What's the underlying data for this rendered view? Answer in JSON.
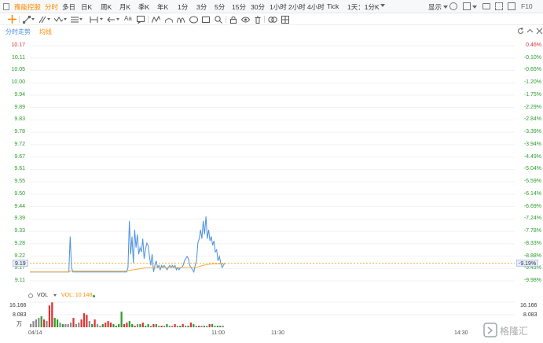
{
  "topbar": {
    "title": "豫能控股",
    "tabs": [
      "分时",
      "多日",
      "日K",
      "周K",
      "月K",
      "季K",
      "年K",
      "1分",
      "3分",
      "5分",
      "15分",
      "30分",
      "1小时",
      "2小时",
      "4小时",
      "Tick",
      "1天：1分K"
    ],
    "active_tab": "分时",
    "display_label": "显示",
    "f10_label": "F10"
  },
  "subbar": {
    "tabs": [
      "分时走势",
      "均线"
    ]
  },
  "price_axis": {
    "left": [
      "10.17",
      "10.11",
      "10.05",
      "10.00",
      "9.94",
      "9.89",
      "9.83",
      "9.78",
      "9.72",
      "9.67",
      "9.61",
      "9.55",
      "9.50",
      "9.44",
      "9.39",
      "9.33",
      "9.28",
      "9.22",
      "9.17",
      "9.11"
    ],
    "right": [
      "0.46%",
      "-0.10%",
      "-0.65%",
      "-1.20%",
      "-1.75%",
      "-2.29%",
      "-2.84%",
      "-3.39%",
      "-3.94%",
      "-4.49%",
      "-5.04%",
      "-5.59%",
      "-6.14%",
      "-6.69%",
      "-7.24%",
      "-7.78%",
      "-8.33%",
      "-8.88%",
      "-9.43%",
      "-9.98%"
    ],
    "current_price": "9.19",
    "current_pct": "-9.19%"
  },
  "volume": {
    "label": "VOL",
    "ma_label": "VOL: 10.148",
    "axis": [
      "16.166",
      "8.083",
      "万"
    ]
  },
  "time_axis": [
    "04/14",
    "11:00",
    "11:30",
    "14:30"
  ],
  "colors": {
    "accent": "#ff8a00",
    "price_line": "#4a90e2",
    "avg_line": "#f5a623",
    "up": "#e03030",
    "down": "#2b9c2b"
  },
  "chart_data": {
    "type": "line",
    "series": [
      {
        "values": [
          9.15,
          9.15,
          9.15,
          9.15,
          9.15,
          9.15,
          9.15,
          9.15,
          9.15,
          9.15,
          9.15,
          9.15,
          9.15,
          9.15,
          9.15,
          9.15,
          9.15,
          9.15,
          9.15,
          9.15,
          9.15,
          9.15,
          9.15,
          9.15,
          9.15,
          9.15,
          9.15,
          9.15,
          9.15,
          9.15,
          9.31,
          9.17,
          9.15,
          9.15,
          9.15,
          9.15,
          9.15,
          9.15,
          9.15,
          9.15,
          9.15,
          9.15,
          9.15,
          9.15,
          9.15,
          9.15,
          9.15,
          9.15,
          9.15,
          9.15,
          9.15,
          9.15,
          9.15,
          9.15,
          9.15,
          9.15,
          9.15,
          9.15,
          9.15,
          9.15,
          9.15,
          9.15,
          9.15,
          9.15,
          9.15,
          9.15,
          9.15,
          9.15,
          9.15,
          9.15,
          9.15,
          9.15,
          9.15,
          9.17,
          9.38,
          9.23,
          9.31,
          9.19,
          9.34,
          9.26,
          9.32,
          9.23,
          9.26,
          9.24,
          9.3,
          9.21,
          9.25,
          9.28,
          9.27,
          9.22,
          9.18,
          9.23,
          9.15,
          9.18,
          9.2,
          9.17,
          9.18,
          9.16,
          9.18,
          9.17,
          9.18,
          9.17,
          9.16,
          9.17,
          9.18,
          9.17,
          9.18,
          9.17,
          9.18,
          9.16,
          9.17,
          9.16,
          9.17,
          9.17,
          9.18,
          9.2,
          9.21,
          9.22,
          9.21,
          9.18,
          9.17,
          9.16,
          9.15,
          9.18,
          9.2,
          9.28,
          9.3,
          9.34,
          9.3,
          9.38,
          9.32,
          9.4,
          9.3,
          9.34,
          9.29,
          9.31,
          9.27,
          9.29,
          9.24,
          9.25,
          9.2,
          9.22,
          9.19,
          9.17,
          9.18,
          9.19
        ]
      },
      {
        "values": [
          9.15,
          9.15,
          9.15,
          9.15,
          9.15,
          9.15,
          9.15,
          9.15,
          9.15,
          9.15,
          9.15,
          9.15,
          9.15,
          9.15,
          9.15,
          9.15,
          9.15,
          9.15,
          9.15,
          9.15,
          9.15,
          9.15,
          9.15,
          9.15,
          9.15,
          9.15,
          9.15,
          9.15,
          9.15,
          9.15,
          9.155,
          9.155,
          9.155,
          9.155,
          9.155,
          9.155,
          9.155,
          9.155,
          9.155,
          9.155,
          9.155,
          9.155,
          9.155,
          9.155,
          9.155,
          9.155,
          9.155,
          9.155,
          9.155,
          9.155,
          9.155,
          9.155,
          9.155,
          9.155,
          9.155,
          9.155,
          9.155,
          9.155,
          9.155,
          9.155,
          9.155,
          9.155,
          9.155,
          9.155,
          9.155,
          9.155,
          9.155,
          9.155,
          9.155,
          9.155,
          9.155,
          9.155,
          9.156,
          9.157,
          9.158,
          9.159,
          9.16,
          9.161,
          9.162,
          9.163,
          9.164,
          9.165,
          9.166,
          9.167,
          9.168,
          9.168,
          9.169,
          9.17,
          9.17,
          9.17,
          9.17,
          9.17,
          9.17,
          9.17,
          9.17,
          9.17,
          9.17,
          9.17,
          9.17,
          9.17,
          9.17,
          9.17,
          9.17,
          9.17,
          9.17,
          9.17,
          9.17,
          9.17,
          9.17,
          9.17,
          9.17,
          9.17,
          9.17,
          9.17,
          9.17,
          9.17,
          9.17,
          9.17,
          9.17,
          9.17,
          9.17,
          9.17,
          9.17,
          9.172,
          9.174,
          9.176,
          9.178,
          9.18,
          9.181,
          9.182,
          9.183,
          9.184,
          9.185,
          9.185,
          9.186,
          9.186,
          9.186,
          9.186,
          9.186,
          9.186,
          9.186,
          9.186,
          9.186,
          9.186
        ]
      }
    ],
    "ylim": [
      9.11,
      10.17
    ],
    "volume": [
      2,
      4,
      5,
      6,
      7,
      5,
      4,
      14,
      16,
      6,
      5,
      3,
      2,
      2,
      2,
      3,
      6,
      2,
      3,
      5,
      9,
      8,
      4,
      2,
      5,
      2,
      1,
      2,
      3,
      4,
      3,
      2,
      1,
      2,
      10,
      2,
      3,
      4,
      2,
      1,
      2,
      2,
      3,
      1,
      2,
      1,
      2,
      2,
      1,
      1,
      1,
      2,
      1,
      1,
      2,
      1,
      1,
      2,
      1,
      1,
      3,
      2,
      1,
      1,
      1,
      1,
      1,
      2,
      2,
      1,
      1,
      1,
      1
    ],
    "volume_colors": [
      "d",
      "d",
      "d",
      "d",
      "g",
      "u",
      "d",
      "u",
      "u",
      "g",
      "g",
      "d",
      "g",
      "d",
      "d",
      "d",
      "u",
      "d",
      "d",
      "u",
      "u",
      "u",
      "d",
      "g",
      "u",
      "d",
      "d",
      "g",
      "u",
      "u",
      "u",
      "g",
      "g",
      "g",
      "g",
      "u",
      "u",
      "g",
      "g",
      "u",
      "d",
      "g",
      "u",
      "g",
      "g",
      "d",
      "u",
      "g",
      "d",
      "u",
      "d",
      "g",
      "d",
      "d",
      "u",
      "d",
      "g",
      "u",
      "d",
      "g",
      "u",
      "g",
      "d",
      "u",
      "d",
      "g",
      "d",
      "u",
      "g",
      "d",
      "g",
      "g",
      "d"
    ],
    "volume_ylim": [
      0,
      16.166
    ]
  }
}
